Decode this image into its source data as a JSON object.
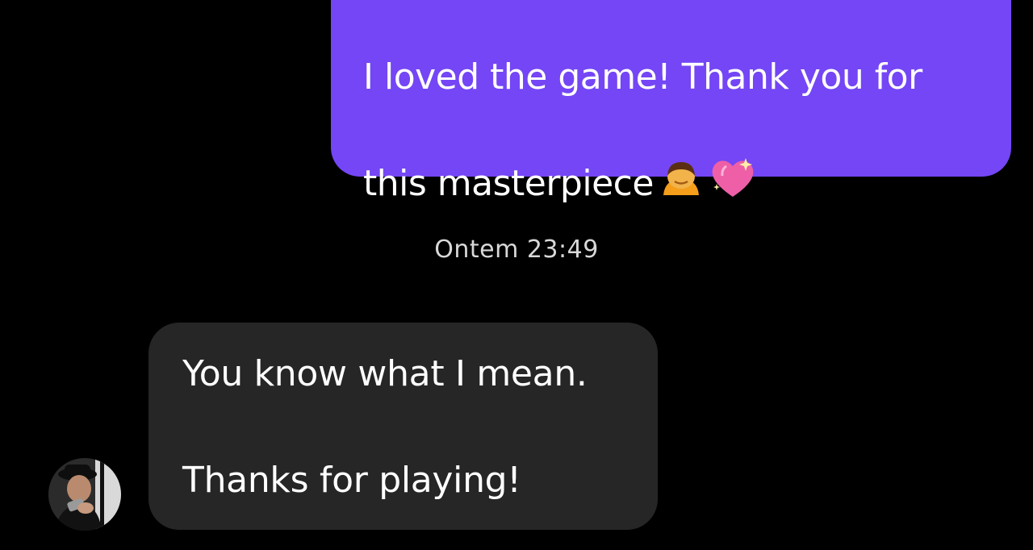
{
  "conversation": {
    "outgoing_message": {
      "text_line1": "I loved the game! Thank you for",
      "text_line2": "this masterpiece",
      "emojis": [
        "person-bowing-emoji",
        "sparkling-heart-emoji"
      ],
      "bubble_color": "#7446f5"
    },
    "timestamp": "Ontem 23:49",
    "incoming_message": {
      "line1": "You know what I mean.",
      "line2": "Thanks for playing!",
      "bubble_color": "#262626"
    },
    "sender_avatar": {
      "icon": "user-avatar-photo"
    }
  }
}
